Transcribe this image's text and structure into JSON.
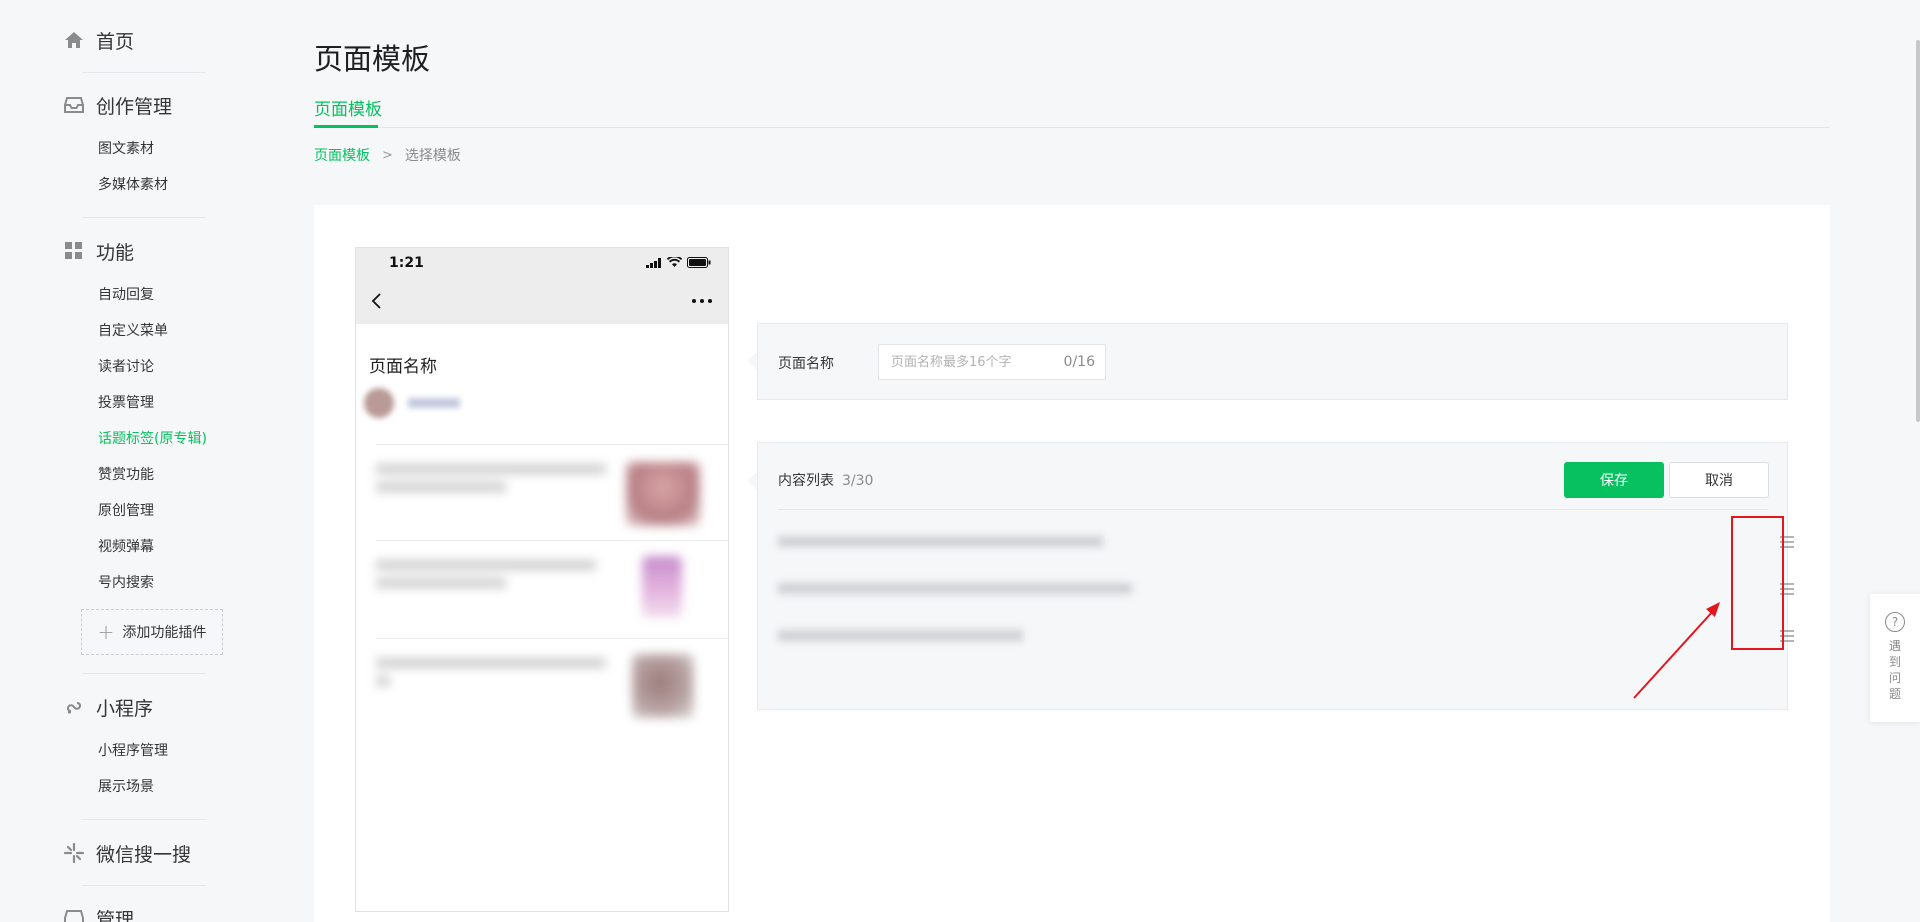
{
  "sidebar": {
    "home": {
      "label": "首页",
      "icon": "home-icon"
    },
    "creation": {
      "label": "创作管理",
      "icon": "inbox-icon",
      "items": [
        "图文素材",
        "多媒体素材"
      ]
    },
    "features": {
      "label": "功能",
      "icon": "grid-icon",
      "items": [
        "自动回复",
        "自定义菜单",
        "读者讨论",
        "投票管理",
        "话题标签(原专辑)",
        "赞赏功能",
        "原创管理",
        "视频弹幕",
        "号内搜索"
      ],
      "active_item": "话题标签(原专辑)"
    },
    "add_plugin": {
      "label": "添加功能插件",
      "icon": "plus-icon"
    },
    "miniprogram": {
      "label": "小程序",
      "icon": "link-icon",
      "items": [
        "小程序管理",
        "展示场景"
      ]
    },
    "search": {
      "label": "微信搜一搜",
      "icon": "sparkle-icon"
    },
    "manage": {
      "label": "管理",
      "icon": "inbox-icon"
    }
  },
  "header": {
    "title": "页面模板",
    "tabs": [
      {
        "label": "页面模板",
        "active": true
      }
    ],
    "breadcrumb": {
      "link": "页面模板",
      "separator": ">",
      "current": "选择模板"
    }
  },
  "phone": {
    "time": "1:21",
    "page_name": "页面名称"
  },
  "name_panel": {
    "label": "页面名称",
    "placeholder": "页面名称最多16个字",
    "value": "",
    "counter": "0/16"
  },
  "list_panel": {
    "label": "内容列表",
    "count": "3/30",
    "save_label": "保存",
    "cancel_label": "取消",
    "row_count": 3
  },
  "help": {
    "label": "遇到问题"
  },
  "colors": {
    "accent": "#07c160",
    "annotation": "#e5151d",
    "page_bg": "#f6f7f8"
  }
}
